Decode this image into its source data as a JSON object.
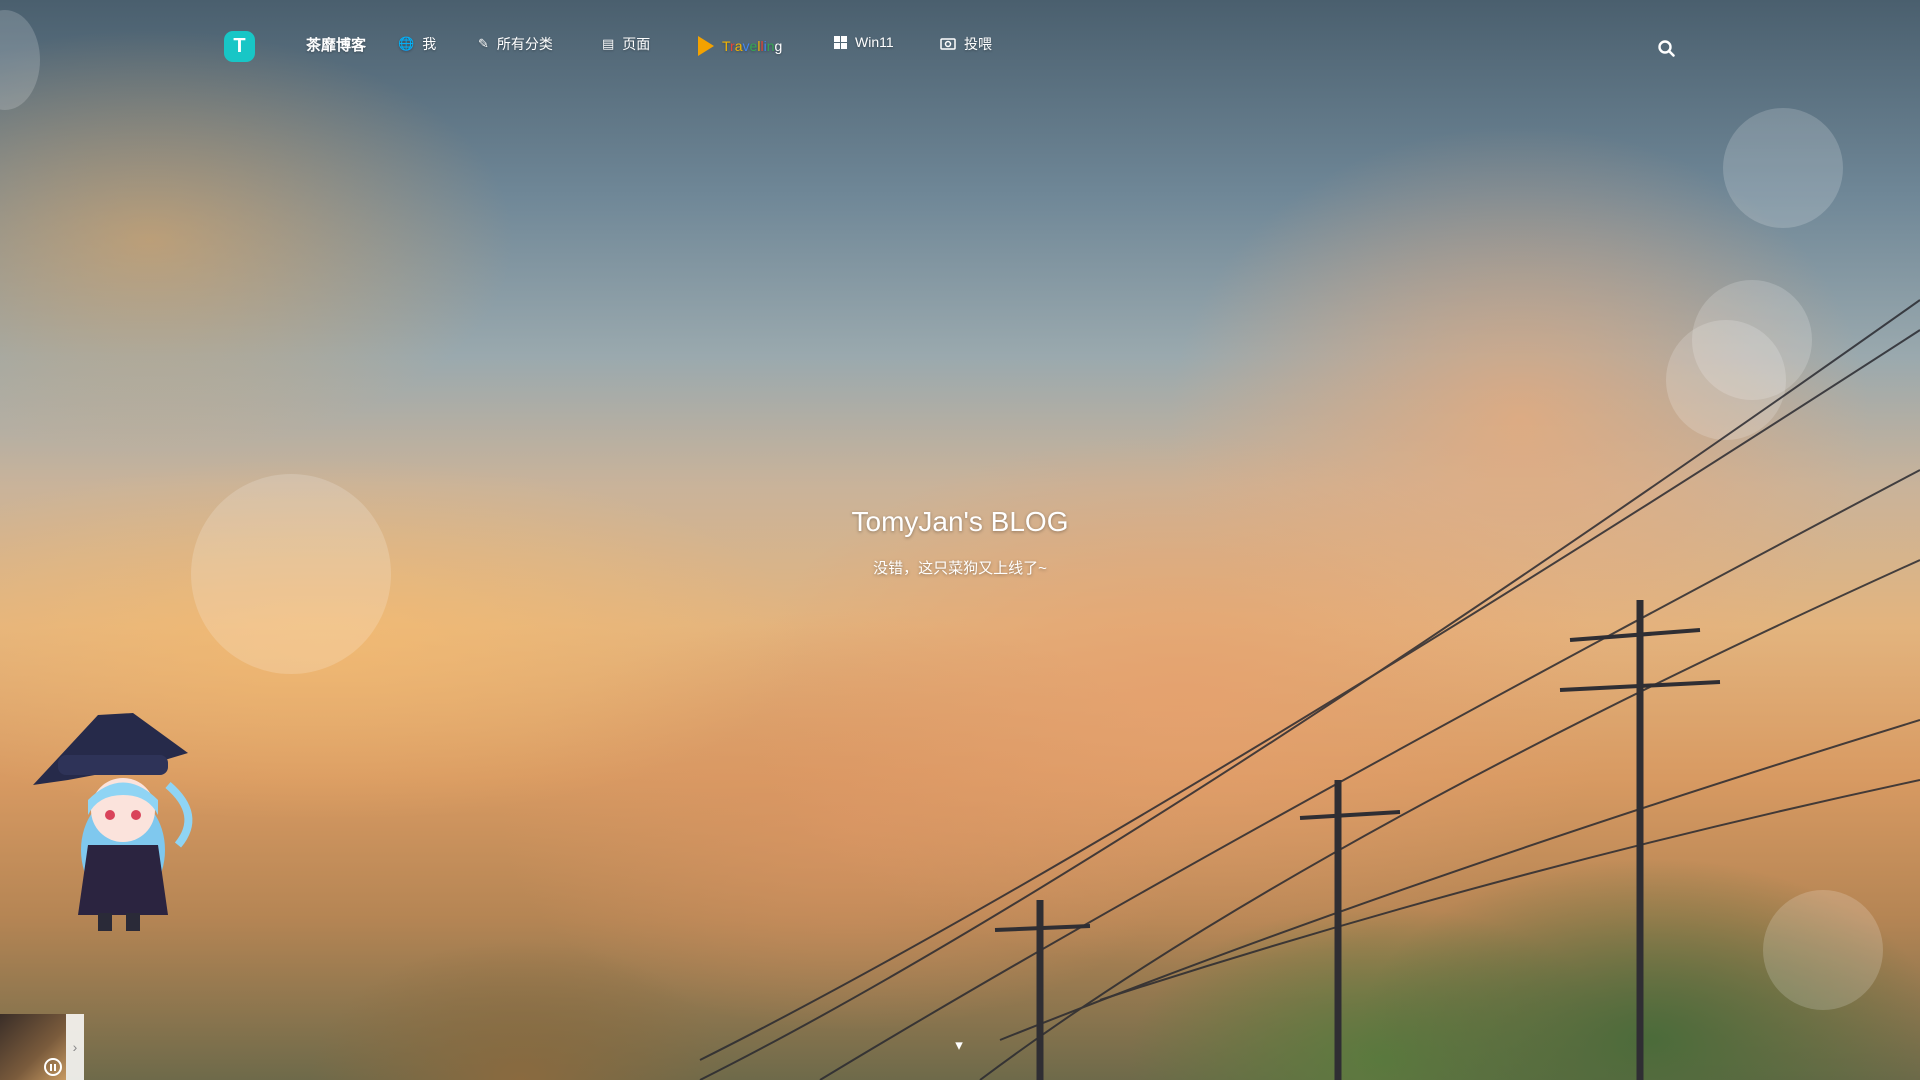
{
  "nav": {
    "logo_letter": "T",
    "brand": "茶靡博客",
    "items": [
      {
        "label": "我",
        "icon": "globe-icon"
      },
      {
        "label": "所有分类",
        "icon": "pencil-icon"
      },
      {
        "label": "页面",
        "icon": "file-icon"
      },
      {
        "label": "Travelling",
        "icon": "play-icon"
      },
      {
        "label": "Win11",
        "icon": "windows-icon"
      },
      {
        "label": "投喂",
        "icon": "money-icon"
      }
    ],
    "search_icon": "search-icon"
  },
  "hero": {
    "title": "TomyJan's BLOG",
    "subtitle": "没错，这只菜狗又上线了~"
  },
  "player": {
    "state": "playing",
    "expand_icon": "chevron-right-icon"
  },
  "colors": {
    "logo": "#18c6c6",
    "travel_icon": "#f4a200"
  }
}
